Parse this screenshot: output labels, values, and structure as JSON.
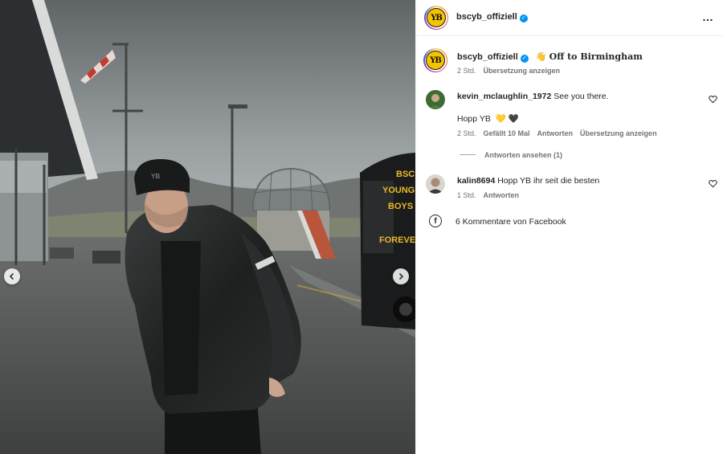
{
  "post": {
    "username": "bscyb_offiziell",
    "more_icon": "…",
    "logo_text": "YB"
  },
  "caption": {
    "username": "bscyb_offiziell",
    "emoji": "👋",
    "text": "Off to Birmingham",
    "time": "2 Std.",
    "translate": "Übersetzung anzeigen"
  },
  "comments": [
    {
      "username": "kevin_mclaughlin_1972",
      "text_line1": "See you there.",
      "text_line2": "Hopp YB",
      "emoji_yellow_heart": "💛",
      "emoji_black_heart": "🖤",
      "time": "2 Std.",
      "likes": "Gefällt 10 Mal",
      "reply": "Antworten",
      "translate": "Übersetzung anzeigen",
      "view_replies": "Antworten ansehen (1)"
    },
    {
      "username": "kalin8694",
      "text": "Hopp YB ihr seit die besten",
      "time": "1 Std.",
      "reply": "Antworten"
    }
  ],
  "facebook": {
    "icon_text": "f",
    "text": "6 Kommentare von Facebook"
  },
  "photo": {
    "bus_text_1": "BSC",
    "bus_text_2": "YOUNG",
    "bus_text_3": "BOYS",
    "bus_text_4": "FOREVER"
  },
  "colors": {
    "accent_blue": "#0095f6",
    "brand_yellow": "#f5c400",
    "secondary_text": "#737373"
  }
}
